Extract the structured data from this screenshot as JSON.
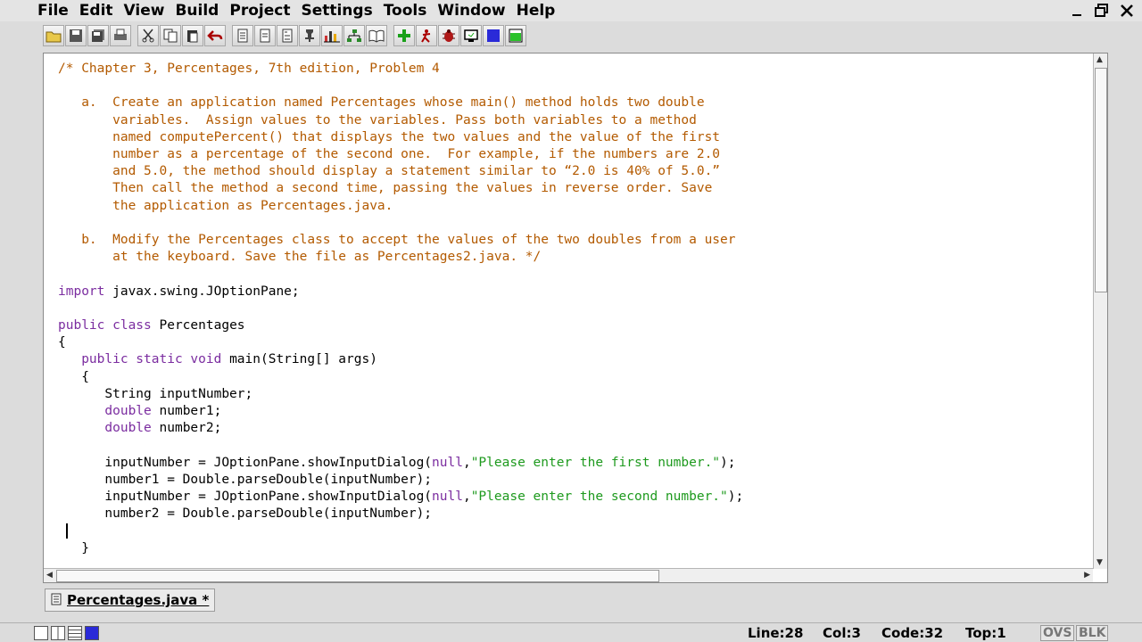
{
  "menu": [
    "File",
    "Edit",
    "View",
    "Build",
    "Project",
    "Settings",
    "Tools",
    "Window",
    "Help"
  ],
  "window_controls": [
    "minimize-icon",
    "restore-icon",
    "close-icon"
  ],
  "toolbar_icons": [
    "open-folder-icon",
    "save-icon",
    "save-all-icon",
    "print-icon",
    "cut-icon",
    "copy-icon",
    "paste-icon",
    "undo-icon",
    "new-file-icon",
    "document-icon",
    "document-edit-icon",
    "pin-icon",
    "chart-icon",
    "tree-icon",
    "book-icon",
    "add-icon",
    "run-icon",
    "debug-bug-icon",
    "monitor-icon",
    "color-square-icon",
    "panel-icon"
  ],
  "code_lines": [
    [
      {
        "t": "/* Chapter 3, Percentages, 7th edition, Problem 4",
        "c": "c"
      }
    ],
    [],
    [
      {
        "t": "   a.  Create an application named Percentages whose main() method holds two double",
        "c": "c"
      }
    ],
    [
      {
        "t": "       variables.  Assign values to the variables. Pass both variables to a method",
        "c": "c"
      }
    ],
    [
      {
        "t": "       named computePercent() that displays the two values and the value of the first",
        "c": "c"
      }
    ],
    [
      {
        "t": "       number as a percentage of the second one.  For example, if the numbers are 2.0",
        "c": "c"
      }
    ],
    [
      {
        "t": "       and 5.0, the method should display a statement similar to “2.0 is 40% of 5.0.”",
        "c": "c"
      }
    ],
    [
      {
        "t": "       Then call the method a second time, passing the values in reverse order. Save",
        "c": "c"
      }
    ],
    [
      {
        "t": "       the application as Percentages.java.",
        "c": "c"
      }
    ],
    [],
    [
      {
        "t": "   b.  Modify the Percentages class to accept the values of the two doubles from a user",
        "c": "c"
      }
    ],
    [
      {
        "t": "       at the keyboard. Save the file as Percentages2.java. */",
        "c": "c"
      }
    ],
    [],
    [
      {
        "t": "import",
        "c": "k"
      },
      {
        "t": " javax.swing.JOptionPane;",
        "c": ""
      }
    ],
    [],
    [
      {
        "t": "public class",
        "c": "k"
      },
      {
        "t": " Percentages",
        "c": ""
      }
    ],
    [
      {
        "t": "{",
        "c": ""
      }
    ],
    [
      {
        "t": "   ",
        "c": ""
      },
      {
        "t": "public static void",
        "c": "k"
      },
      {
        "t": " main(String[] args)",
        "c": ""
      }
    ],
    [
      {
        "t": "   {",
        "c": ""
      }
    ],
    [
      {
        "t": "      String inputNumber;",
        "c": ""
      }
    ],
    [
      {
        "t": "      ",
        "c": ""
      },
      {
        "t": "double",
        "c": "k"
      },
      {
        "t": " number1;",
        "c": ""
      }
    ],
    [
      {
        "t": "      ",
        "c": ""
      },
      {
        "t": "double",
        "c": "k"
      },
      {
        "t": " number2;",
        "c": ""
      }
    ],
    [],
    [
      {
        "t": "      inputNumber = JOptionPane.showInputDialog(",
        "c": ""
      },
      {
        "t": "null",
        "c": "k"
      },
      {
        "t": ",",
        "c": ""
      },
      {
        "t": "\"Please enter the first number.\"",
        "c": "s"
      },
      {
        "t": ");",
        "c": ""
      }
    ],
    [
      {
        "t": "      number1 = Double.parseDouble(inputNumber);",
        "c": ""
      }
    ],
    [
      {
        "t": "      inputNumber = JOptionPane.showInputDialog(",
        "c": ""
      },
      {
        "t": "null",
        "c": "k"
      },
      {
        "t": ",",
        "c": ""
      },
      {
        "t": "\"Please enter the second number.\"",
        "c": "s"
      },
      {
        "t": ");",
        "c": ""
      }
    ],
    [
      {
        "t": "      number2 = Double.parseDouble(inputNumber);",
        "c": ""
      }
    ],
    [
      {
        "t": " ",
        "c": ""
      },
      {
        "t": "CARET",
        "c": "caret"
      }
    ],
    [
      {
        "t": "   }",
        "c": ""
      }
    ]
  ],
  "tab": {
    "label": "Percentages.java *"
  },
  "status": {
    "line": "Line:28",
    "col": "Col:3",
    "code": "Code:32",
    "top": "Top:1",
    "ovs": "OVS",
    "blk": "BLK"
  },
  "colors": {
    "comment": "#b35a00",
    "keyword": "#7b2da0",
    "string": "#1e9a1e"
  }
}
